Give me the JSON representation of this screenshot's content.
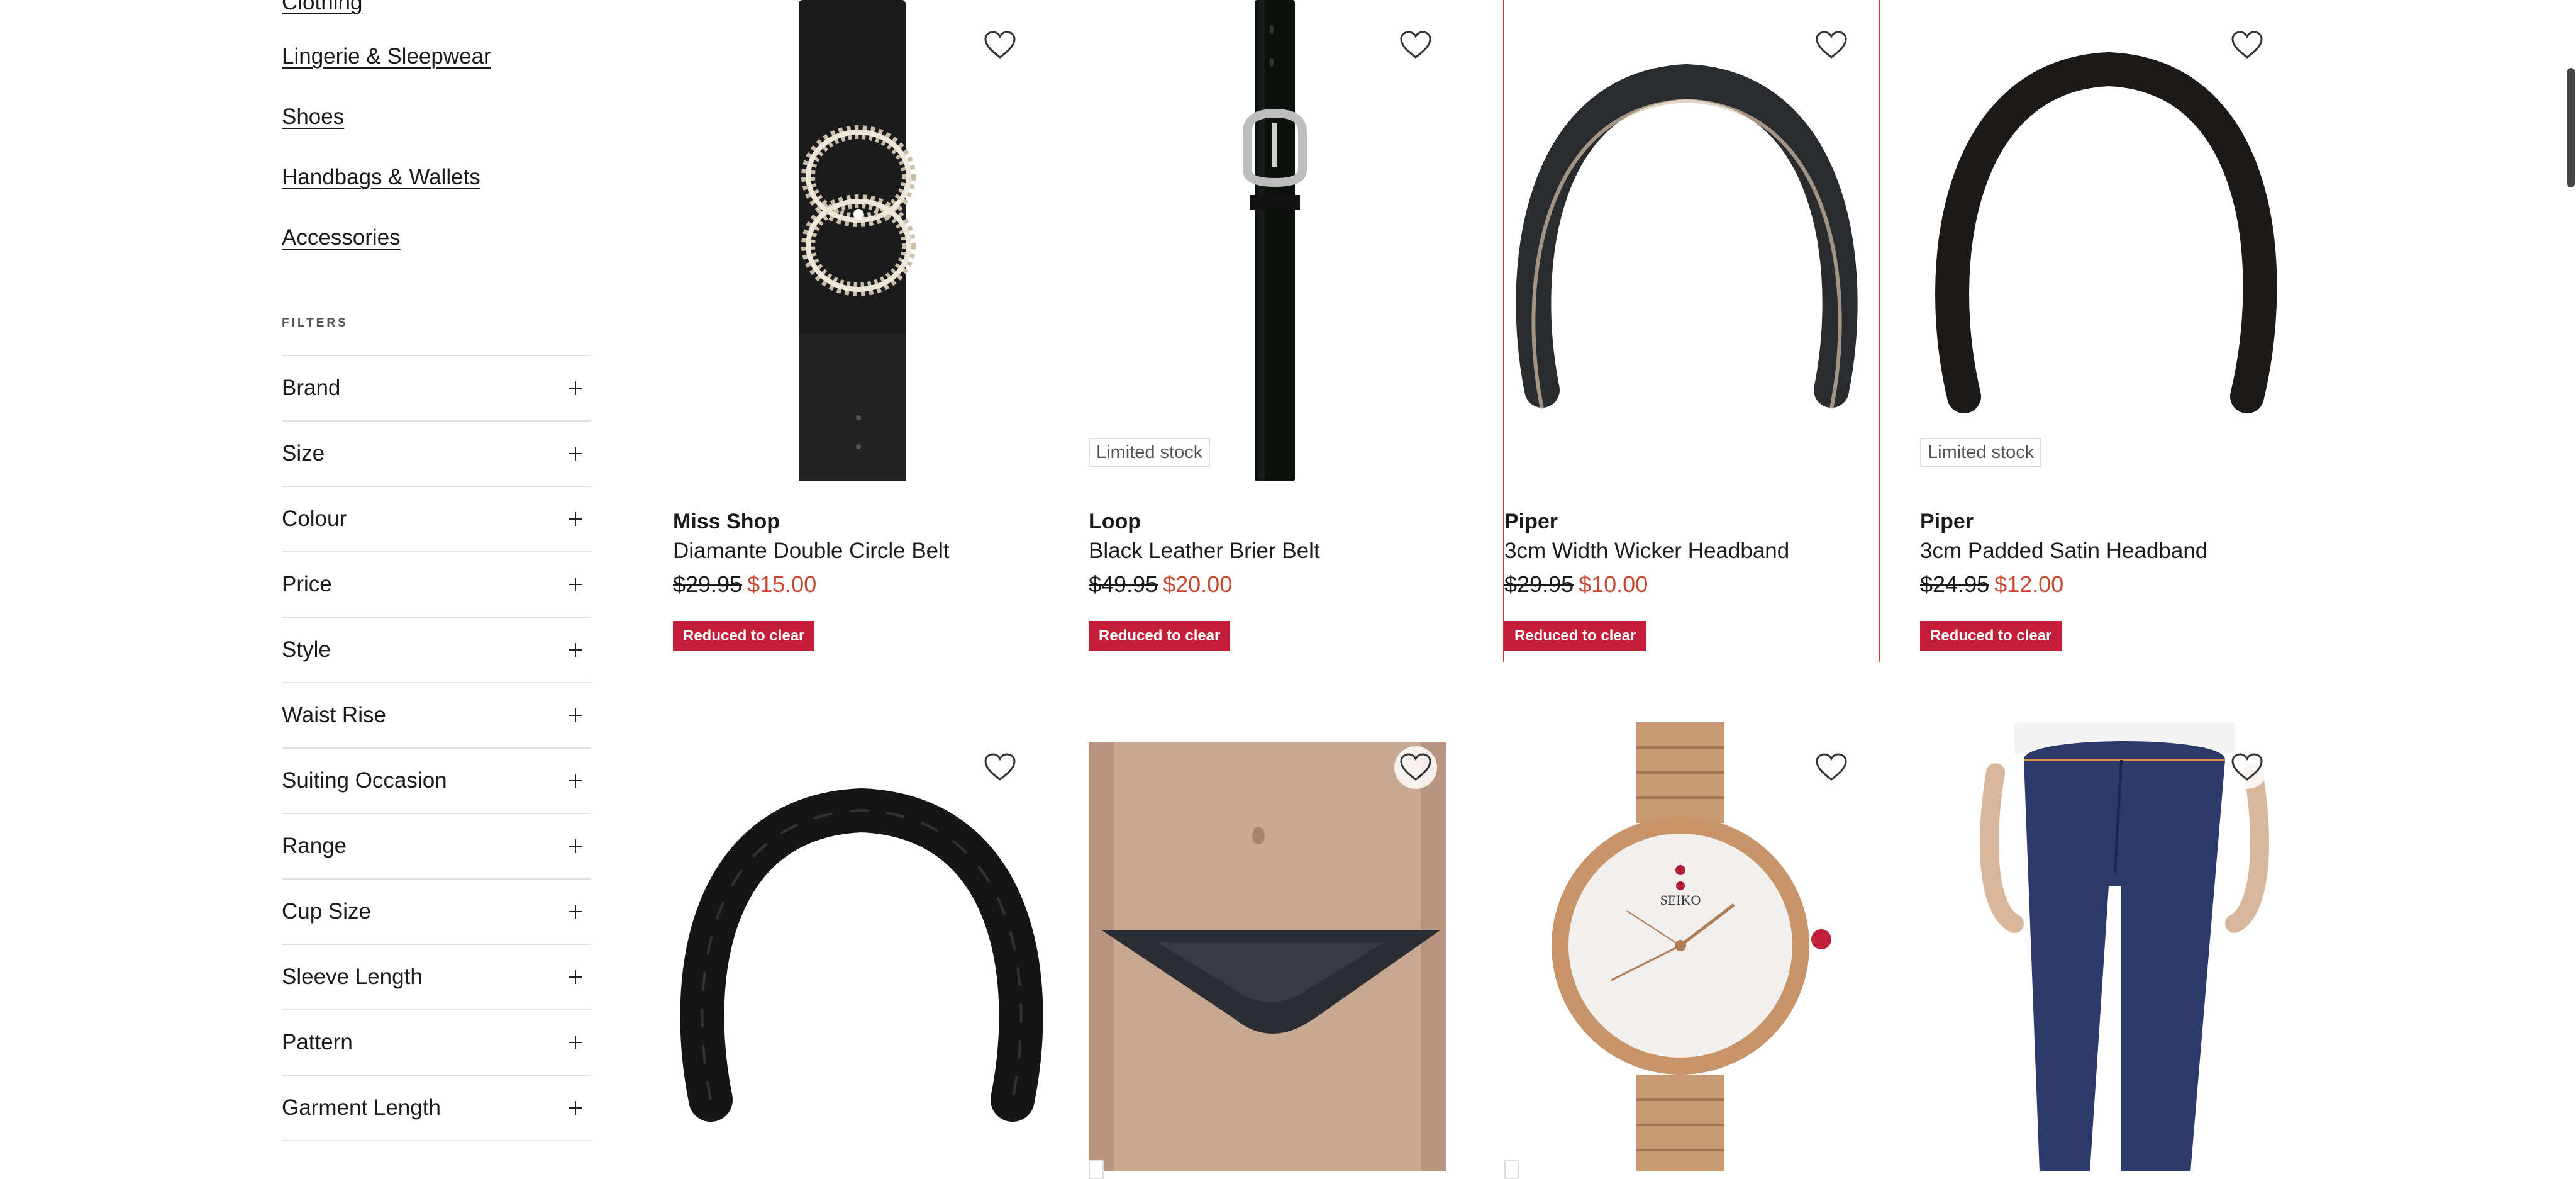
{
  "sidebar": {
    "categories": [
      "Clothing",
      "Lingerie & Sleepwear",
      "Shoes",
      "Handbags & Wallets",
      "Accessories"
    ],
    "filters_heading": "FILTERS",
    "filters": [
      "Brand",
      "Size",
      "Colour",
      "Price",
      "Style",
      "Waist Rise",
      "Suiting Occasion",
      "Range",
      "Cup Size",
      "Sleeve Length",
      "Pattern",
      "Garment Length"
    ]
  },
  "products": [
    {
      "brand": "Miss Shop",
      "name": "Diamante Double Circle Belt",
      "was_price": "$29.95",
      "now_price": "$15.00",
      "tag": "Reduced to clear",
      "stock": ""
    },
    {
      "brand": "Loop",
      "name": "Black Leather Brier Belt",
      "was_price": "$49.95",
      "now_price": "$20.00",
      "tag": "Reduced to clear",
      "stock": "Limited stock"
    },
    {
      "brand": "Piper",
      "name": "3cm Width Wicker Headband",
      "was_price": "$29.95",
      "now_price": "$10.00",
      "tag": "Reduced to clear",
      "stock": ""
    },
    {
      "brand": "Piper",
      "name": "3cm Padded Satin Headband",
      "was_price": "$24.95",
      "now_price": "$12.00",
      "tag": "Reduced to clear",
      "stock": "Limited stock"
    }
  ],
  "watch": {
    "dial_brand": "SEIKO"
  },
  "icons": {
    "wishlist": "heart-outline-icon",
    "expand": "plus-icon"
  },
  "colors": {
    "sale_price": "#c8462d",
    "clear_tag": "#c51e3a",
    "hover_border": "#e3342f"
  }
}
